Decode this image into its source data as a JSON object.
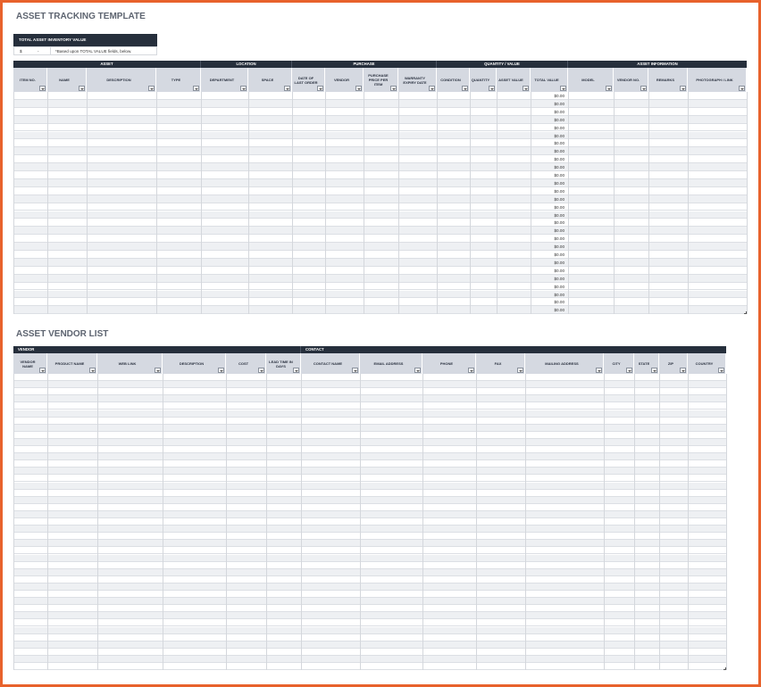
{
  "asset_title": "ASSET TRACKING TEMPLATE",
  "total_box": {
    "label": "TOTAL ASSET INVENTORY VALUE",
    "currency": "$",
    "dash": "-",
    "note": "*Based upon TOTAL VALUE fields, below."
  },
  "asset_groups": [
    "ASSET",
    "LOCATION",
    "PURCHASE",
    "QUANTITY / VALUE",
    "ASSET INFORMATION"
  ],
  "asset_columns": [
    "ITEM NO.",
    "NAME",
    "DESCRIPTION",
    "TYPE",
    "DEPARTMENT",
    "SPACE",
    "DATE OF LAST ORDER",
    "VENDOR",
    "PURCHASE PRICE PER ITEM",
    "WARRANTY EXPIRY DATE",
    "CONDITION",
    "QUANTITY",
    "ASSET VALUE",
    "TOTAL VALUE",
    "MODEL",
    "VENDOR NO.",
    "REMARKS",
    "PHOTOGRAPH / LINK"
  ],
  "asset_total_values": [
    "$0.00",
    "$0.00",
    "$0.00",
    "$0.00",
    "$0.00",
    "$0.00",
    "$0.00",
    "$0.00",
    "$0.00",
    "$0.00",
    "$0.00",
    "$0.00",
    "$0.00",
    "$0.00",
    "$0.00",
    "$0.00",
    "$0.00",
    "$0.00",
    "$0.00",
    "$0.00",
    "$0.00",
    "$0.00",
    "$0.00",
    "$0.00",
    "$0.00",
    "$0.00",
    "$0.00",
    "$0.00"
  ],
  "vendor_title": "ASSET VENDOR LIST",
  "vendor_groups": [
    "VENDOR",
    "CONTACT"
  ],
  "vendor_columns": [
    "VENDOR NAME",
    "PRODUCT NAME",
    "WEB LINK",
    "DESCRIPTION",
    "COST",
    "LEAD TIME IN DAYS",
    "CONTACT NAME",
    "EMAIL ADDRESS",
    "PHONE",
    "FAX",
    "MAILING ADDRESS",
    "CITY",
    "STATE",
    "ZIP",
    "COUNTRY"
  ],
  "colors": {
    "border": "#e8622c",
    "header_dark": "#262f3c",
    "header_light": "#d5d9e1",
    "row_alt": "#eef0f3",
    "title": "#5d6470"
  }
}
